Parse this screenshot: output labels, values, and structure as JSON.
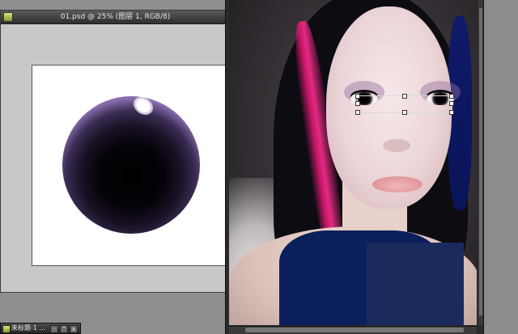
{
  "left_document": {
    "title": "01.psd @ 25% (图层 1, RGB/8)"
  },
  "minimized_document": {
    "title": "未标题-1 ...",
    "buttons": [
      "-",
      "^",
      "x"
    ]
  },
  "icons": {
    "document": "ps-document-icon",
    "center": "transform-center-icon"
  },
  "colors": {
    "chrome_dark": "#2e2e2e",
    "workspace_gray": "#8f8f8f",
    "iris_purple": "#8a70b0",
    "hair_magenta": "#c81769"
  }
}
